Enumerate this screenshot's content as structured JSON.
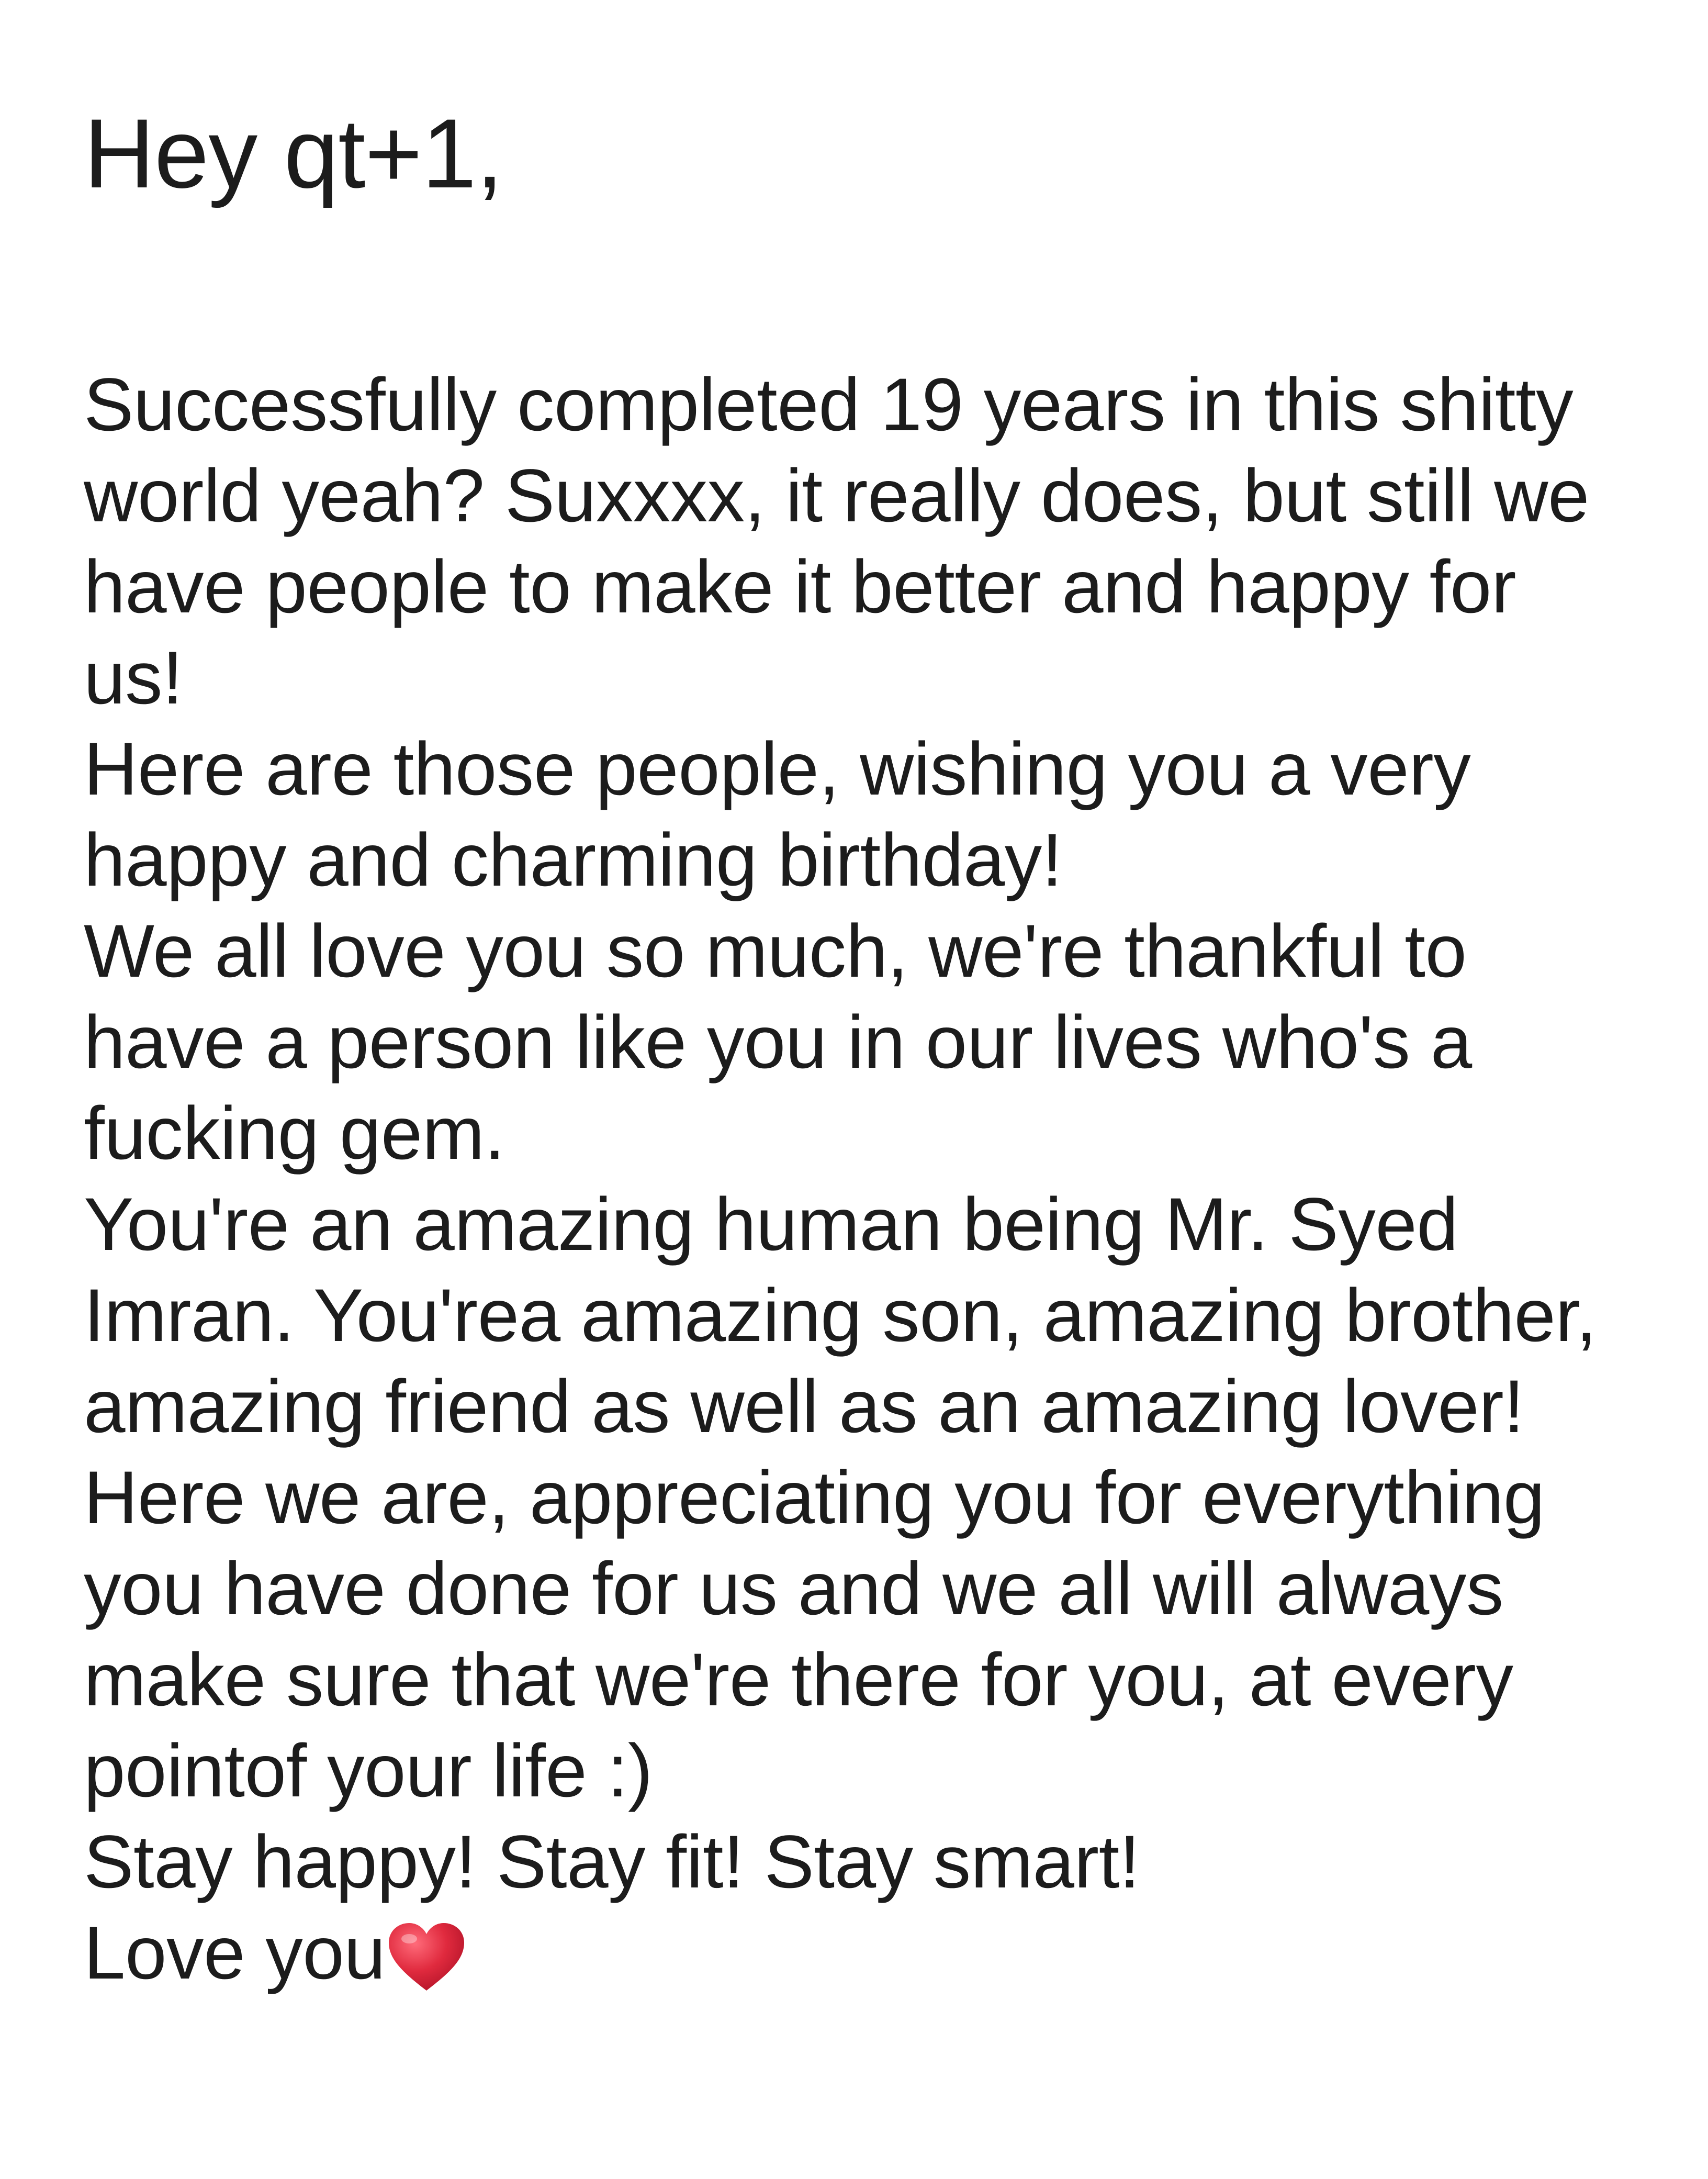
{
  "note": {
    "greeting": "Hey qt+1,",
    "lines": [
      "Successfully completed 19 years in this shitty",
      "world yeah? Suxxxx, it really does, but still we",
      "have people to make it better and happy for",
      "us!",
      "Here are those people, wishing you a very",
      "happy and charming birthday!",
      "We all love you so much, we're thankful to",
      "have a person like you in our lives who's a",
      "fucking gem.",
      "You're an amazing human being Mr. Syed",
      "Imran. You'rea amazing son, amazing brother,",
      "amazing friend as well as an amazing lover!",
      "Here we are, appreciating you for everything",
      "you have done for us and we all will always",
      "make sure that we're there for you, at every",
      "pointof your life :)",
      "Stay happy! Stay fit! Stay smart!",
      "Love you"
    ],
    "heart_icon": "red-heart-emoji",
    "heart_color": "#d7263d"
  }
}
